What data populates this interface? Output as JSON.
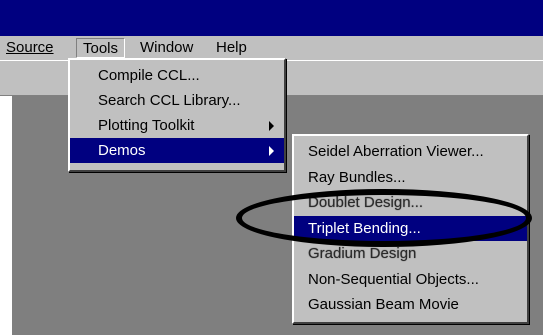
{
  "menubar": {
    "items": [
      {
        "label": "Source",
        "name": "menu-source"
      },
      {
        "label": "Tools",
        "name": "menu-tools"
      },
      {
        "label": "Window",
        "name": "menu-window"
      },
      {
        "label": "Help",
        "name": "menu-help"
      }
    ]
  },
  "tools_menu": {
    "items": [
      {
        "label": "Compile CCL..."
      },
      {
        "label": "Search CCL Library..."
      },
      {
        "label": "Plotting Toolkit",
        "submenu": true
      },
      {
        "label": "Demos",
        "submenu": true,
        "active": true
      }
    ]
  },
  "demos_menu": {
    "items": [
      {
        "label": "Seidel Aberration Viewer..."
      },
      {
        "label": "Ray Bundles..."
      },
      {
        "label": "Doublet Design..."
      },
      {
        "label": "Triplet Bending...",
        "active": true
      },
      {
        "label": "Gradium Design"
      },
      {
        "label": "Non-Sequential Objects..."
      },
      {
        "label": "Gaussian Beam Movie"
      }
    ]
  },
  "colors": {
    "title_bar": "#000080",
    "highlight": "#000080",
    "chrome": "#c0c0c0",
    "workspace": "#7f7f7f"
  }
}
